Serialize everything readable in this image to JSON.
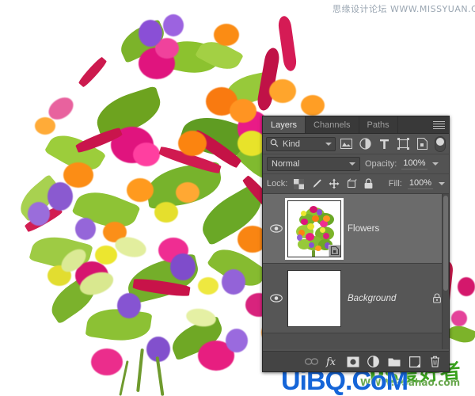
{
  "watermarks": {
    "top": "思缘设计论坛  WWW.MISSYUAN.COM",
    "bottom_blue": "UiBQ.CoM",
    "bottom_green": "PS爱好者",
    "bottom_url": "WWW.PSahao.com"
  },
  "panel": {
    "tabs": [
      {
        "label": "Layers",
        "active": true
      },
      {
        "label": "Channels",
        "active": false
      },
      {
        "label": "Paths",
        "active": false
      }
    ],
    "menu_icon": "hamburger-menu-icon",
    "filter": {
      "kind_label": "Kind",
      "search_icon": "search-icon",
      "icons": [
        "pixel-layer-filter-icon",
        "adjustment-layer-filter-icon",
        "type-layer-filter-icon",
        "shape-layer-filter-icon",
        "smart-object-filter-icon"
      ],
      "toggle_icon": "filter-enable-toggle"
    },
    "blend": {
      "mode": "Normal",
      "opacity_label": "Opacity:",
      "opacity_value": "100%"
    },
    "lock": {
      "label": "Lock:",
      "icons": [
        "lock-transparency-icon",
        "lock-image-pixels-icon",
        "lock-position-icon",
        "lock-artboard-nesting-icon",
        "lock-all-icon"
      ],
      "fill_label": "Fill:",
      "fill_value": "100%"
    },
    "layers": [
      {
        "name": "Flowers",
        "selected": true,
        "italic": false,
        "visible": true,
        "eye_icon": "eye-visibility-icon",
        "thumb": "flowers-layer-thumbnail",
        "badge": "smart-object-badge-icon",
        "locked": false
      },
      {
        "name": "Background",
        "selected": false,
        "italic": true,
        "visible": true,
        "eye_icon": "eye-visibility-icon",
        "thumb": "white-background-thumbnail",
        "badge": null,
        "locked": true,
        "lock_icon": "layer-locked-icon"
      }
    ],
    "bottom_toolbar": [
      "link-layers-icon",
      "layer-style-fx-icon",
      "add-layer-mask-icon",
      "new-adjustment-layer-icon",
      "new-group-icon",
      "new-layer-icon",
      "delete-layer-icon"
    ],
    "colors": {
      "panel_bg": "#535353",
      "tab_bg": "#393939",
      "row_selected": "#6b6b6b",
      "row_normal": "#565656",
      "text": "#d8d8d8"
    }
  }
}
